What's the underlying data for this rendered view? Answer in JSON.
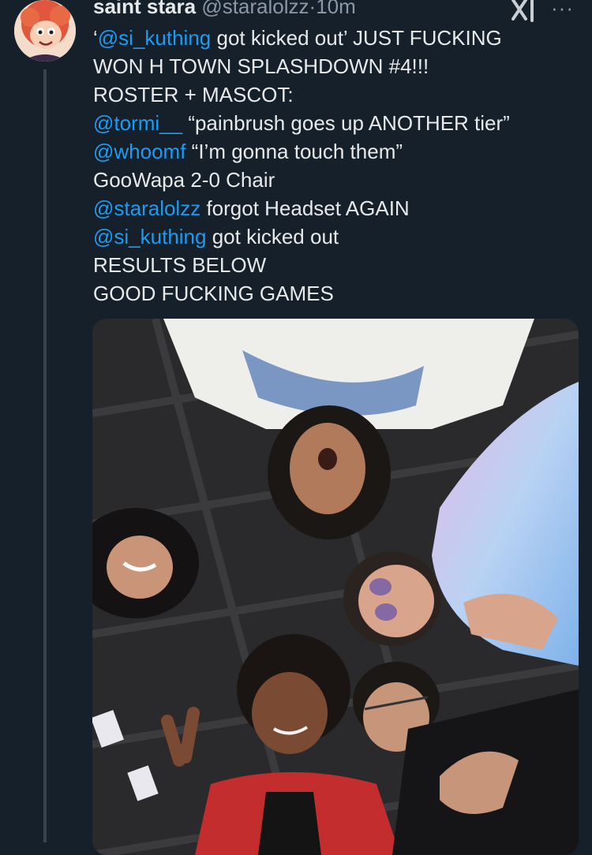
{
  "tweet": {
    "display_name": "saint stara",
    "handle": "@staralolzz",
    "separator": "·",
    "time": "10m",
    "lines": [
      [
        {
          "t": "‘",
          "m": false
        },
        {
          "t": "@si_kuthing",
          "m": true
        },
        {
          "t": " got kicked out’ JUST FUCKING",
          "m": false
        }
      ],
      [
        {
          "t": "WON H TOWN SPLASHDOWN #4!!!",
          "m": false
        }
      ],
      [
        {
          "t": "ROSTER + MASCOT:",
          "m": false
        }
      ],
      [
        {
          "t": "@tormi__",
          "m": true
        },
        {
          "t": " “painbrush goes up ANOTHER tier”",
          "m": false
        }
      ],
      [
        {
          "t": "@whoomf",
          "m": true
        },
        {
          "t": " “I’m gonna touch them”",
          "m": false
        }
      ],
      [
        {
          "t": "GooWapa 2-0 Chair",
          "m": false
        }
      ],
      [
        {
          "t": "@staralolzz",
          "m": true
        },
        {
          "t": " forgot Headset AGAIN",
          "m": false
        }
      ],
      [
        {
          "t": "@si_kuthing",
          "m": true
        },
        {
          "t": " got kicked out",
          "m": false
        }
      ],
      [
        {
          "t": "RESULTS BELOW",
          "m": false
        }
      ],
      [
        {
          "t": "GOOD FUCKING GAMES",
          "m": false
        }
      ]
    ]
  },
  "icons": {
    "avatar": "cartoon-avatar",
    "logo": "x-logo-icon",
    "more": "more-options-icon"
  },
  "more_glyph": "···",
  "colors": {
    "background": "#15202b",
    "text": "#e7e9ea",
    "secondary": "#8b98a5",
    "mention": "#1d9bf0"
  }
}
